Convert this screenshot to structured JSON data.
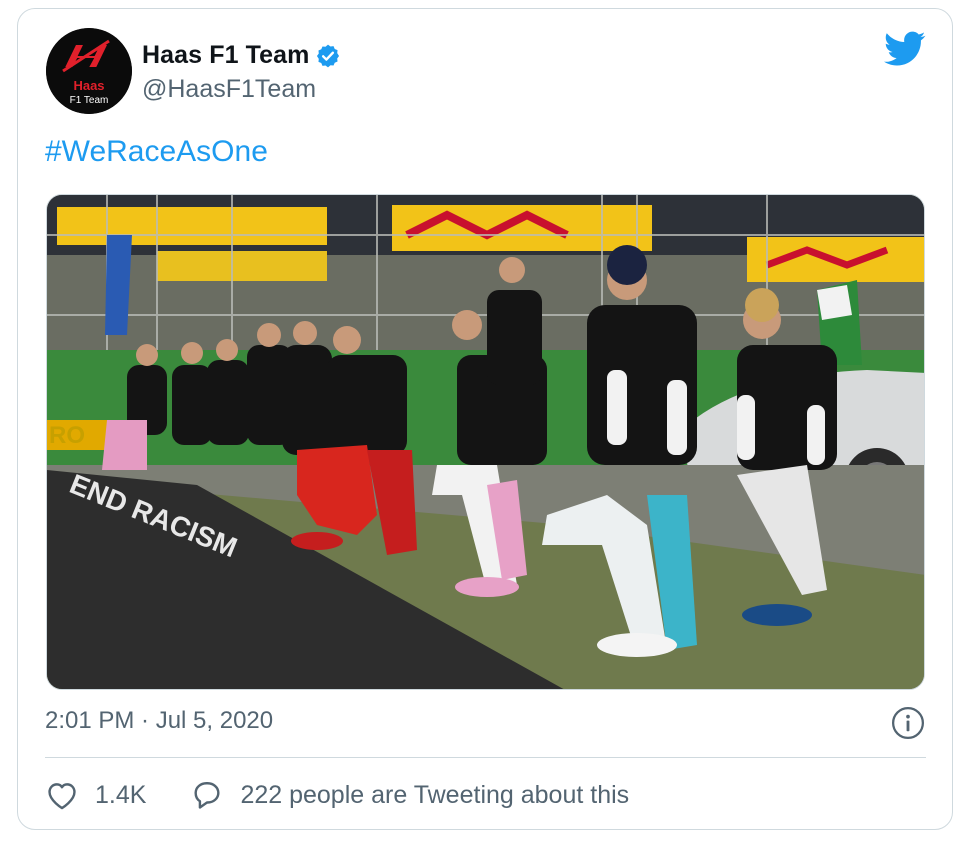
{
  "tweet": {
    "author": {
      "display_name": "Haas F1 Team",
      "handle": "@HaasF1Team",
      "verified": true,
      "avatar_text_line1": "Haas",
      "avatar_text_line2": "F1 Team"
    },
    "text": "#WeRaceAsOne",
    "timestamp": "2:01 PM · Jul 5, 2020",
    "likes": "1.4K",
    "conversation_label": "222 people are Tweeting about this"
  },
  "icons": {
    "platform": "twitter-bird-icon",
    "verified": "verified-badge-icon",
    "info": "info-icon",
    "like": "heart-icon",
    "reply": "speech-bubble-icon"
  },
  "colors": {
    "accent": "#1d9bf0",
    "secondary_text": "#536471",
    "border": "#cfd9de",
    "brand_red": "#e1202b"
  }
}
